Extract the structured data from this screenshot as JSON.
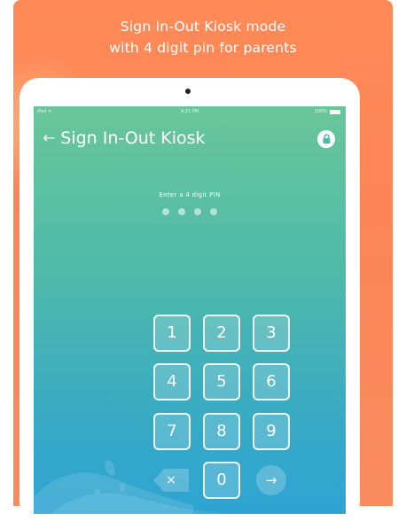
{
  "caption": {
    "line1": "Sign In-Out Kiosk mode",
    "line2": "with 4 digit pin for parents"
  },
  "statusbar": {
    "carrier": "iPad ᯤ",
    "time": "4:21 PM",
    "battery": "100%"
  },
  "navbar": {
    "back_icon": "←",
    "title": "Sign In-Out Kiosk"
  },
  "pin": {
    "prompt": "Enter a 4 digit PIN",
    "digits_entered": 0,
    "length": 4
  },
  "keypad": {
    "k1": "1",
    "k2": "2",
    "k3": "3",
    "k4": "4",
    "k5": "5",
    "k6": "6",
    "k7": "7",
    "k8": "8",
    "k9": "9",
    "k0": "0",
    "delete": "×",
    "enter": "→"
  },
  "colors": {
    "background_orange": "#fb8556",
    "screen_top": "#6ac69a",
    "screen_bottom": "#2ea4d3"
  },
  "icons": {
    "lock": "lock-icon",
    "back": "back-arrow-icon",
    "delete": "backspace-icon",
    "enter": "arrow-right-icon"
  }
}
